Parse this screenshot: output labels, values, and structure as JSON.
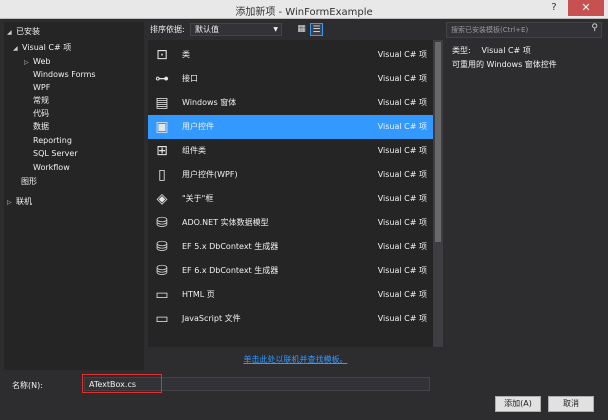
{
  "window": {
    "title": "添加新项 - WinFormExample",
    "help": "?",
    "close": "✕"
  },
  "tree": {
    "installed": "已安装",
    "visual_csharp": "Visual C# 项",
    "children": [
      "Web",
      "Windows Forms",
      "WPF",
      "常规",
      "代码",
      "数据",
      "Reporting",
      "SQL Server",
      "Workflow"
    ],
    "graphics": "图形",
    "online": "联机"
  },
  "toolbar": {
    "sort_label": "排序依据:",
    "sort_value": "默认值"
  },
  "search": {
    "placeholder": "搜索已安装模板(Ctrl+E)"
  },
  "items": [
    {
      "name": "类",
      "category": "Visual C# 项",
      "icon": "class-icon"
    },
    {
      "name": "接口",
      "category": "Visual C# 项",
      "icon": "interface-icon"
    },
    {
      "name": "Windows 窗体",
      "category": "Visual C# 项",
      "icon": "windows-form-icon"
    },
    {
      "name": "用户控件",
      "category": "Visual C# 项",
      "icon": "user-control-icon"
    },
    {
      "name": "组件类",
      "category": "Visual C# 项",
      "icon": "component-class-icon"
    },
    {
      "name": "用户控件(WPF)",
      "category": "Visual C# 项",
      "icon": "wpf-user-control-icon"
    },
    {
      "name": "\"关于\"框",
      "category": "Visual C# 项",
      "icon": "about-box-icon"
    },
    {
      "name": "ADO.NET 实体数据模型",
      "category": "Visual C# 项",
      "icon": "entity-model-icon"
    },
    {
      "name": "EF 5.x DbContext 生成器",
      "category": "Visual C# 项",
      "icon": "ef5-generator-icon"
    },
    {
      "name": "EF 6.x DbContext 生成器",
      "category": "Visual C# 项",
      "icon": "ef6-generator-icon"
    },
    {
      "name": "HTML 页",
      "category": "Visual C# 项",
      "icon": "html-page-icon"
    },
    {
      "name": "JavaScript 文件",
      "category": "Visual C# 项",
      "icon": "javascript-file-icon"
    }
  ],
  "selected_index": 3,
  "online_link": "单击此处以联机并查找模板。",
  "description": {
    "type_label": "类型:",
    "type_value": "Visual C# 项",
    "text": "可重用的 Windows 窗体控件"
  },
  "name_field": {
    "label": "名称(N):",
    "value": "ATextBox.cs"
  },
  "buttons": {
    "add": "添加(A)",
    "cancel": "取消"
  }
}
